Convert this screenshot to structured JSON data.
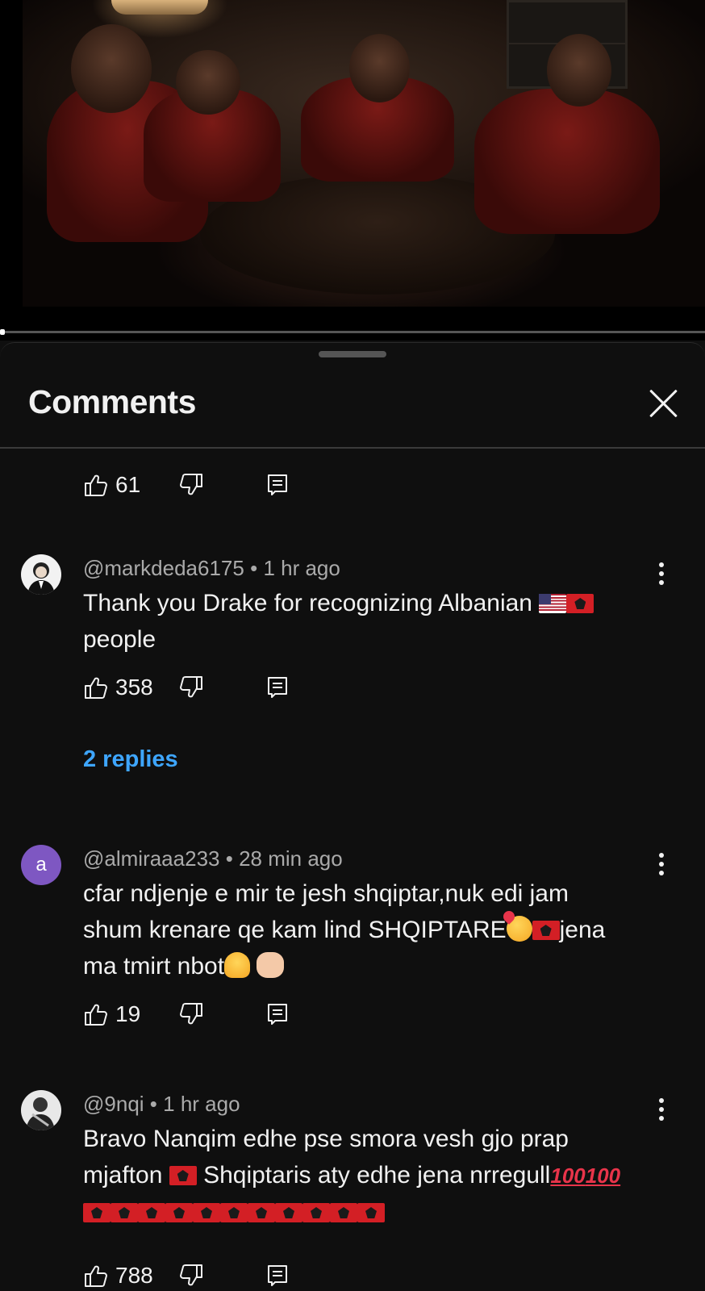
{
  "sheet": {
    "title": "Comments"
  },
  "top_actions": {
    "like_count": "61"
  },
  "comments": [
    {
      "handle": "@markdeda6175",
      "time": "1 hr ago",
      "text_line1": "Thank you Drake for recognizing Albanian",
      "text_line2": "people",
      "like_count": "358",
      "replies_label": "2 replies"
    },
    {
      "handle": "@almiraaa233",
      "time": "28 min ago",
      "avatar_letter": "a",
      "avatar_color": "#7e57c2",
      "text_line1": "cfar ndjenje e mir te jesh shqiptar,nuk edi jam",
      "text_line2a": "shum krenare qe kam lind SHQIPTARE",
      "text_line2b": "jena",
      "text_line3": "ma tmirt nbot",
      "like_count": "19"
    },
    {
      "handle": "@9nqi",
      "time": "1 hr ago",
      "text_line1": "Bravo Nanqim edhe pse smora vesh gjo prap",
      "text_line2a": "mjafton",
      "text_line2b": "Shqiptaris aty edhe jena nrregull",
      "hundred": "100",
      "like_count": "788"
    }
  ],
  "meta_separator": "•",
  "colors": {
    "background": "#0f0f0f",
    "text": "#f1f1f1",
    "secondary_text": "#aaaaaa",
    "link": "#3ea6ff"
  },
  "icons": [
    "thumb-up-icon",
    "thumb-down-icon",
    "reply-icon",
    "close-icon",
    "more-vertical-icon",
    "albania-flag-icon",
    "us-flag-icon"
  ]
}
